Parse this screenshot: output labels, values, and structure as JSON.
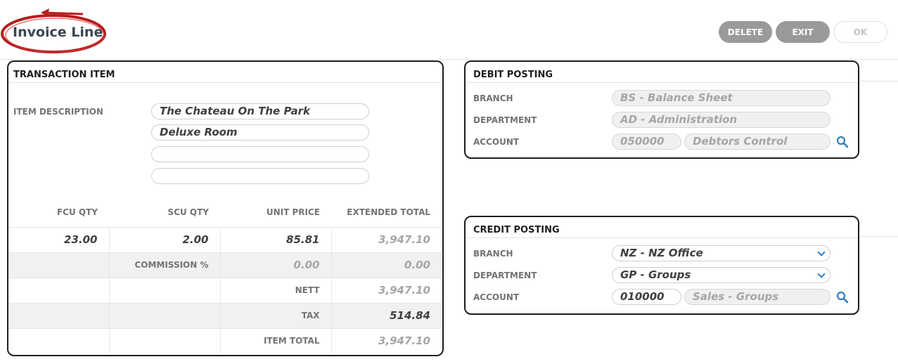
{
  "header": {
    "title": "Invoice Line"
  },
  "toolbar": {
    "delete_label": "DELETE",
    "exit_label": "EXIT",
    "ok_label": "OK"
  },
  "transaction": {
    "title": "TRANSACTION ITEM",
    "item_description_label": "ITEM DESCRIPTION",
    "descriptions": [
      "The Chateau On The Park",
      "Deluxe Room",
      "",
      ""
    ],
    "columns": [
      "FCU QTY",
      "SCU QTY",
      "UNIT PRICE",
      "EXTENDED TOTAL"
    ],
    "fcu_qty": "23.00",
    "scu_qty": "2.00",
    "unit_price": "85.81",
    "extended_total": "3,947.10",
    "commission_label": "COMMISSION %",
    "commission_pct": "0.00",
    "commission_amount": "0.00",
    "nett_label": "NETT",
    "nett": "3,947.10",
    "tax_label": "TAX",
    "tax": "514.84",
    "item_total_label": "ITEM TOTAL",
    "item_total": "3,947.10"
  },
  "debit": {
    "title": "DEBIT POSTING",
    "branch_label": "BRANCH",
    "branch": "BS - Balance Sheet",
    "department_label": "DEPARTMENT",
    "department": "AD - Administration",
    "account_label": "ACCOUNT",
    "account_code": "050000",
    "account_name": "Debtors Control"
  },
  "credit": {
    "title": "CREDIT POSTING",
    "branch_label": "BRANCH",
    "branch": "NZ - NZ Office",
    "department_label": "DEPARTMENT",
    "department": "GP - Groups",
    "account_label": "ACCOUNT",
    "account_code": "010000",
    "account_name": "Sales - Groups"
  },
  "colors": {
    "accent_blue": "#2b7dc4",
    "highlight_red": "#b81d1d",
    "button_grey": "#9a9a9a"
  }
}
